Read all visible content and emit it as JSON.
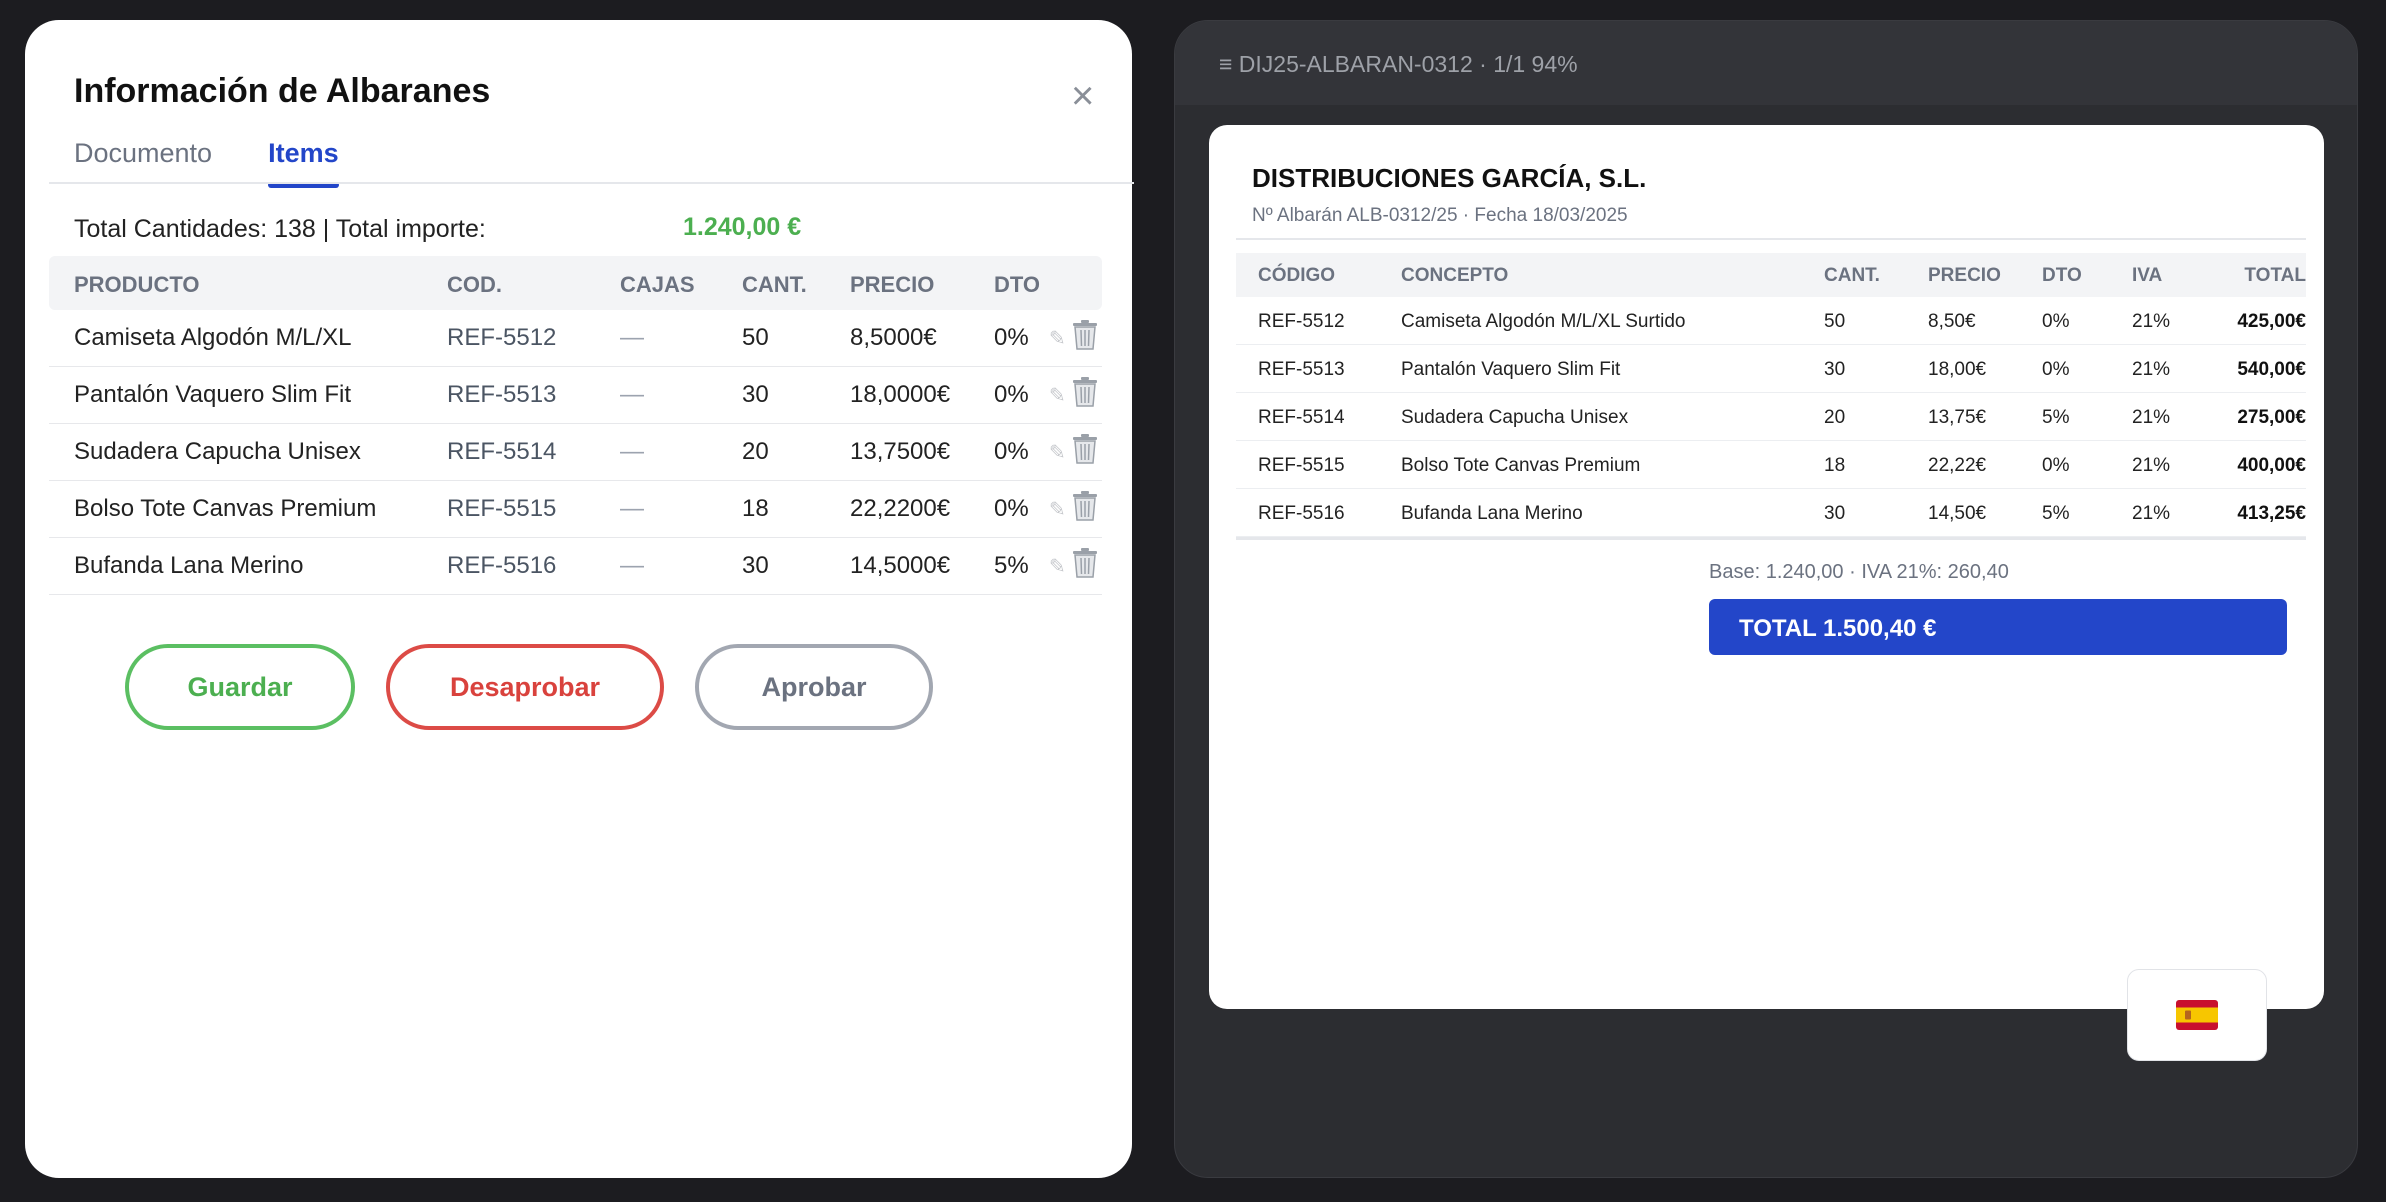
{
  "modal": {
    "title": "Información de Albaranes",
    "close_glyph": "×",
    "tabs": [
      {
        "label": "Documento",
        "active": false
      },
      {
        "label": "Items",
        "active": true
      }
    ],
    "summary_text": "Total Cantidades: 138 | Total importe:",
    "summary_value": "1.240,00 €",
    "columns": [
      "PRODUCTO",
      "COD.",
      "CAJAS",
      "CANT.",
      "PRECIO",
      "DTO"
    ],
    "rows": [
      {
        "producto": "Camiseta Algodón M/L/XL",
        "cod": "REF-5512",
        "cajas": "—",
        "cant": "50",
        "precio": "8,5000€",
        "dto": "0%"
      },
      {
        "producto": "Pantalón Vaquero Slim Fit",
        "cod": "REF-5513",
        "cajas": "—",
        "cant": "30",
        "precio": "18,0000€",
        "dto": "0%"
      },
      {
        "producto": "Sudadera Capucha Unisex",
        "cod": "REF-5514",
        "cajas": "—",
        "cant": "20",
        "precio": "13,7500€",
        "dto": "0%"
      },
      {
        "producto": "Bolso Tote Canvas Premium",
        "cod": "REF-5515",
        "cajas": "—",
        "cant": "18",
        "precio": "22,2200€",
        "dto": "0%"
      },
      {
        "producto": "Bufanda Lana Merino",
        "cod": "REF-5516",
        "cajas": "—",
        "cant": "30",
        "precio": "14,5000€",
        "dto": "5%"
      }
    ],
    "row_icons": {
      "edit": "pencil-icon",
      "delete": "trash-icon"
    },
    "buttons": {
      "save": "Guardar",
      "reject": "Desaprobar",
      "approve": "Aprobar"
    },
    "colors": {
      "accent": "#2346c9",
      "success": "#4caf50",
      "danger": "#d9423d",
      "neutral": "#6b7280"
    }
  },
  "viewer": {
    "title": "≡ DIJ25-ALBARAN-0312 · 1/1 94%",
    "doc": {
      "company": "DISTRIBUCIONES GARCÍA, S.L.",
      "info": "Nº Albarán ALB-0312/25 · Fecha 18/03/2025",
      "columns": [
        "CÓDIGO",
        "CONCEPTO",
        "CANT.",
        "PRECIO",
        "DTO",
        "IVA",
        "TOTAL"
      ],
      "rows": [
        {
          "codigo": "REF-5512",
          "concepto": "Camiseta Algodón M/L/XL Surtido",
          "cant": "50",
          "precio": "8,50€",
          "dto": "0%",
          "iva": "21%",
          "total": "425,00€"
        },
        {
          "codigo": "REF-5513",
          "concepto": "Pantalón Vaquero Slim Fit",
          "cant": "30",
          "precio": "18,00€",
          "dto": "0%",
          "iva": "21%",
          "total": "540,00€"
        },
        {
          "codigo": "REF-5514",
          "concepto": "Sudadera Capucha Unisex",
          "cant": "20",
          "precio": "13,75€",
          "dto": "5%",
          "iva": "21%",
          "total": "275,00€"
        },
        {
          "codigo": "REF-5515",
          "concepto": "Bolso Tote Canvas Premium",
          "cant": "18",
          "precio": "22,22€",
          "dto": "0%",
          "iva": "21%",
          "total": "400,00€"
        },
        {
          "codigo": "REF-5516",
          "concepto": "Bufanda Lana Merino",
          "cant": "30",
          "precio": "14,50€",
          "dto": "5%",
          "iva": "21%",
          "total": "413,25€"
        }
      ],
      "base_line": "Base: 1.240,00 · IVA 21%: 260,40",
      "total": "TOTAL 1.500,40 €"
    },
    "language_icon": "spain-flag-icon"
  }
}
